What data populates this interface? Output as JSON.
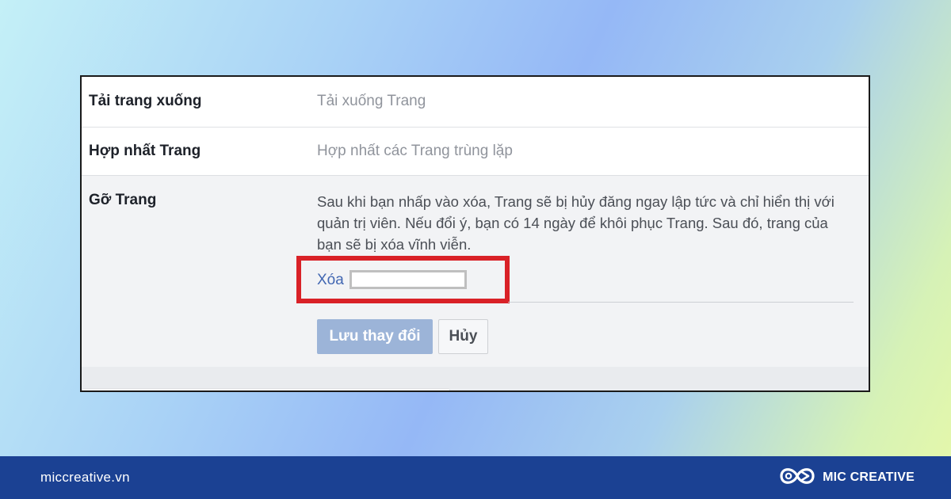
{
  "settings": {
    "rows": [
      {
        "label": "Tải trang xuống",
        "value": "Tải xuống Trang"
      },
      {
        "label": "Hợp nhất Trang",
        "value": "Hợp nhất các Trang trùng lặp"
      },
      {
        "label": "Gỡ Trang",
        "value": ""
      }
    ],
    "remove": {
      "description": "Sau khi bạn nhấp vào xóa, Trang sẽ bị hủy đăng ngay lập tức và chỉ hiển thị với quản trị viên. Nếu đổi ý, bạn có 14 ngày để khôi phục Trang. Sau đó, trang của bạn sẽ bị xóa vĩnh viễn.",
      "delete_label": "Xóa",
      "delete_input_value": "",
      "save_label": "Lưu thay đổi",
      "cancel_label": "Hủy"
    }
  },
  "footer": {
    "website": "miccreative.vn",
    "brand_name": "MIC CREATIVE",
    "logo_icon": "infinity-loop-logo-icon"
  },
  "colors": {
    "highlight": "#d92127",
    "footer_bg": "#1b4193",
    "link": "#4267b2",
    "save_button": "#9cb4d8"
  }
}
